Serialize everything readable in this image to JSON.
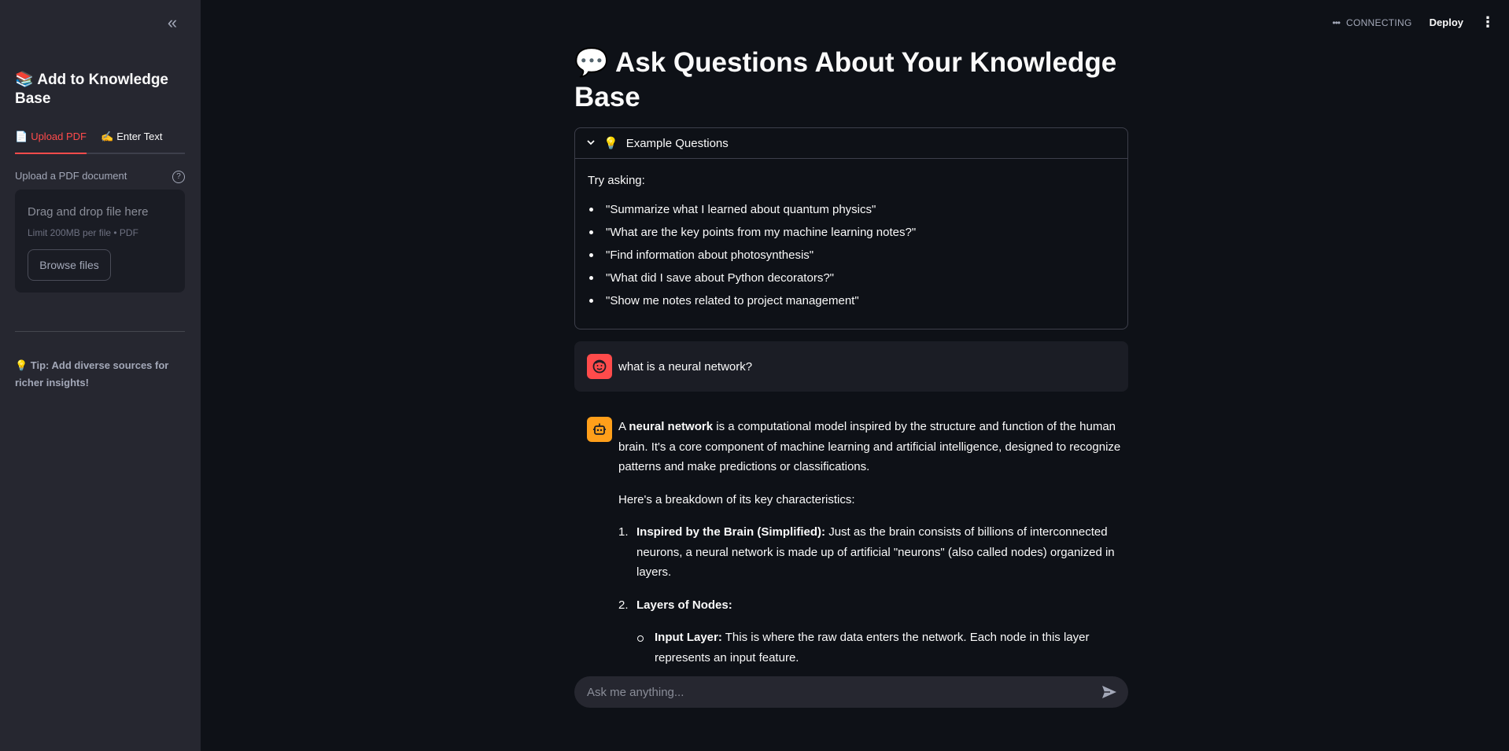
{
  "sidebar": {
    "title": "📚 Add to Knowledge Base",
    "tabs": [
      {
        "icon": "📄",
        "label": "Upload PDF"
      },
      {
        "icon": "✍️",
        "label": "Enter Text"
      }
    ],
    "upload_label": "Upload a PDF document",
    "dropzone": {
      "main_text": "Drag and drop file here",
      "limit_text": "Limit 200MB per file • PDF",
      "browse_label": "Browse files"
    },
    "tip": "💡 Tip: Add diverse sources for richer insights!"
  },
  "header": {
    "status": "CONNECTING",
    "deploy_label": "Deploy"
  },
  "main": {
    "title": "💬 Ask Questions About Your Knowledge Base",
    "examples": {
      "header_icon": "💡",
      "header_label": "Example Questions",
      "intro": "Try asking:",
      "items": [
        "\"Summarize what I learned about quantum physics\"",
        "\"What are the key points from my machine learning notes?\"",
        "\"Find information about photosynthesis\"",
        "\"What did I save about Python decorators?\"",
        "\"Show me notes related to project management\""
      ]
    },
    "user_message": "what is a neural network?",
    "assistant_message": {
      "p1_prefix": "A ",
      "p1_bold": "neural network",
      "p1_rest": " is a computational model inspired by the structure and function of the human brain. It's a core component of machine learning and artificial intelligence, designed to recognize patterns and make predictions or classifications.",
      "p2": "Here's a breakdown of its key characteristics:",
      "items": [
        {
          "num": "1.",
          "bold": "Inspired by the Brain (Simplified):",
          "text": " Just as the brain consists of billions of interconnected neurons, a neural network is made up of artificial \"neurons\" (also called nodes) organized in layers."
        },
        {
          "num": "2.",
          "bold": "Layers of Nodes:",
          "text": "",
          "sub": [
            {
              "bold": "Input Layer:",
              "text": " This is where the raw data enters the network. Each node in this layer represents an input feature."
            }
          ]
        }
      ]
    },
    "chat_input_placeholder": "Ask me anything..."
  },
  "colors": {
    "accent": "#ff4b4b",
    "bot_avatar": "#ff9f1a",
    "background": "#0e1117",
    "sidebar": "#262730"
  }
}
